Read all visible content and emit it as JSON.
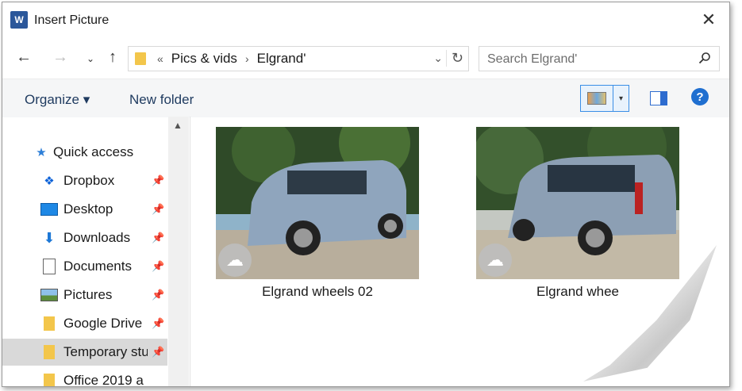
{
  "window": {
    "title": "Insert Picture",
    "app_icon_letter": "W",
    "close_glyph": "✕"
  },
  "navigation": {
    "back_glyph": "←",
    "forward_glyph": "→",
    "recent_glyph": "⌄",
    "up_glyph": "↑"
  },
  "address": {
    "overflow": "«",
    "crumbs": [
      "Pics & vids",
      "Elgrand'"
    ],
    "separator": "›",
    "dropdown_glyph": "⌄",
    "refresh_glyph": "↻"
  },
  "search": {
    "placeholder": "Search Elgrand'",
    "icon": "search-icon"
  },
  "toolbar": {
    "organize_label": "Organize ▾",
    "new_folder_label": "New folder",
    "view_dropdown_glyph": "▾",
    "help_label": "?"
  },
  "sidebar": {
    "items": [
      {
        "label": "Quick access",
        "icon": "star-icon",
        "pinned": false
      },
      {
        "label": "Dropbox",
        "icon": "dropbox-icon",
        "pinned": true
      },
      {
        "label": "Desktop",
        "icon": "desktop-icon",
        "pinned": true
      },
      {
        "label": "Downloads",
        "icon": "download-icon",
        "pinned": true
      },
      {
        "label": "Documents",
        "icon": "document-icon",
        "pinned": true
      },
      {
        "label": "Pictures",
        "icon": "picture-icon",
        "pinned": true
      },
      {
        "label": "Google Drive",
        "icon": "folder-icon",
        "pinned": true
      },
      {
        "label": "Temporary stu",
        "icon": "folder-icon",
        "pinned": true
      },
      {
        "label": "Office 2019 a",
        "icon": "folder-icon",
        "pinned": false
      }
    ],
    "pin_glyph": "📌",
    "scroll_up_glyph": "▲"
  },
  "files": [
    {
      "name": "Elgrand wheels 02",
      "sync_status": "cloud"
    },
    {
      "name": "Elgrand whee",
      "sync_status": "cloud"
    }
  ],
  "colors": {
    "accent": "#3a8ee6",
    "folder": "#f3c64b",
    "selected_row": "#d9d9d9"
  }
}
